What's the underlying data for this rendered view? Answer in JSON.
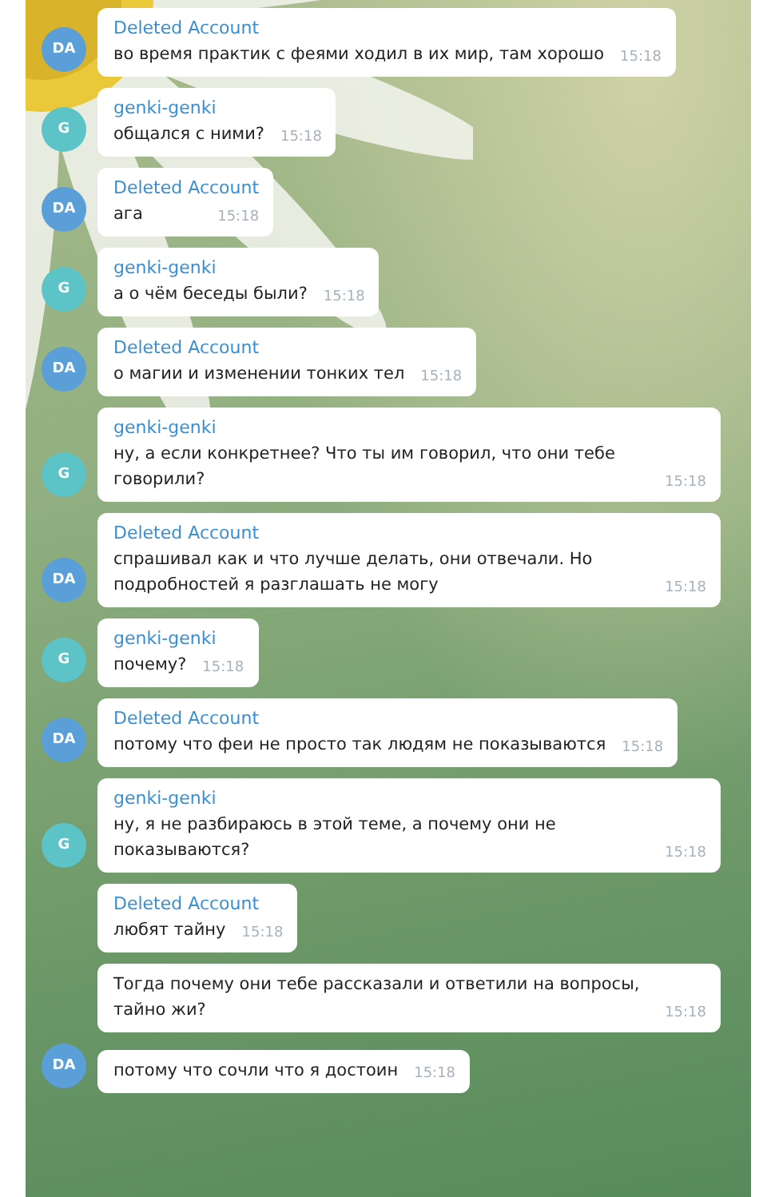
{
  "messages": [
    {
      "sender": "Deleted Account",
      "text": "во время практик с феями ходил в их мир, там хорошо",
      "time": "15:18",
      "avatar": {
        "initials": "DA",
        "color": "#5b9fd8"
      }
    },
    {
      "sender": "genki-genki",
      "text": "общался с ними?",
      "time": "15:18",
      "avatar": {
        "initials": "G",
        "color": "#5cc3c7"
      }
    },
    {
      "sender": "Deleted Account",
      "text": "ага",
      "time": "15:18",
      "avatar": {
        "initials": "DA",
        "color": "#5b9fd8"
      }
    },
    {
      "sender": "genki-genki",
      "text": "а о чём беседы были?",
      "time": "15:18",
      "avatar": {
        "initials": "G",
        "color": "#5cc3c7"
      }
    },
    {
      "sender": "Deleted Account",
      "text": "о магии и изменении тонких тел",
      "time": "15:18",
      "avatar": {
        "initials": "DA",
        "color": "#5b9fd8"
      }
    },
    {
      "sender": "genki-genki",
      "text": "ну, а если конкретнее? Что ты им говорил, что они тебе говорили?",
      "time": "15:18",
      "avatar": {
        "initials": "G",
        "color": "#5cc3c7"
      }
    },
    {
      "sender": "Deleted Account",
      "text": "спрашивал как и что лучше делать, они отвечали. Но подробностей я разглашать не могу",
      "time": "15:18",
      "avatar": {
        "initials": "DA",
        "color": "#5b9fd8"
      }
    },
    {
      "sender": "genki-genki",
      "text": "почему?",
      "time": "15:18",
      "avatar": {
        "initials": "G",
        "color": "#5cc3c7"
      }
    },
    {
      "sender": "Deleted Account",
      "text": "потому что феи не просто так людям не показываются",
      "time": "15:18",
      "avatar": {
        "initials": "DA",
        "color": "#5b9fd8"
      }
    },
    {
      "sender": "genki-genki",
      "text": "ну, я не разбираюсь в этой теме, а почему они не показываются?",
      "time": "15:18",
      "avatar": {
        "initials": "G",
        "color": "#5cc3c7"
      }
    },
    {
      "sender": "Deleted Account",
      "text": "любят тайну",
      "time": "15:18"
    },
    {
      "text": "Тогда почему они тебе рассказали и ответили на вопросы, тайно жи?",
      "time": "15:18"
    },
    {
      "text": "потому что сочли что я достоин",
      "time": "15:18",
      "avatar": {
        "initials": "DA",
        "color": "#5b9fd8"
      }
    }
  ]
}
